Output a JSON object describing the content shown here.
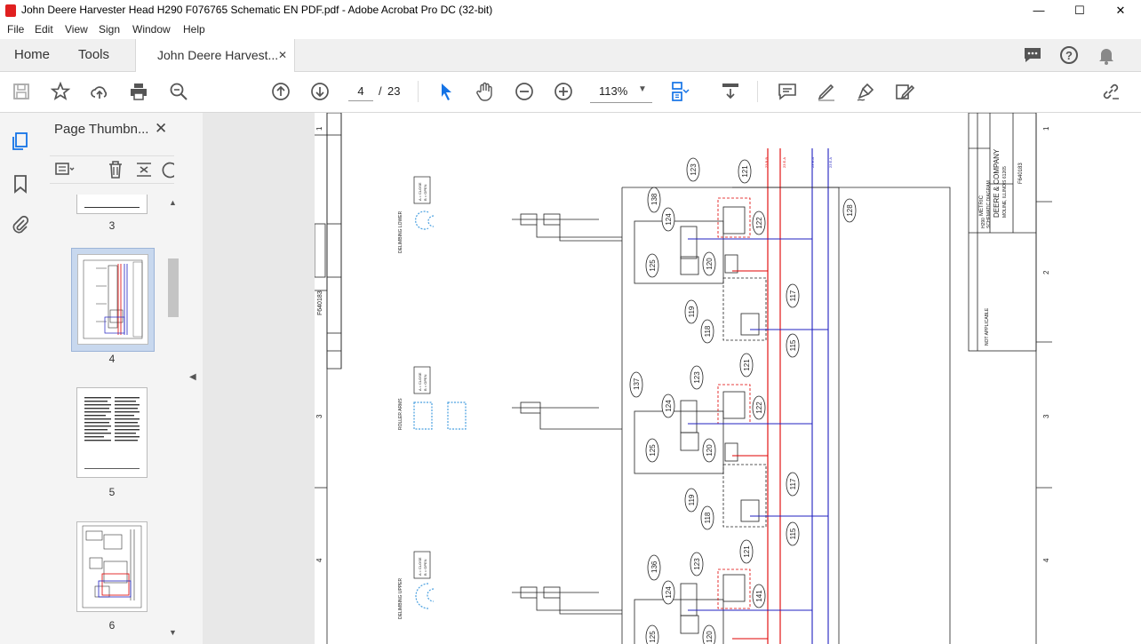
{
  "window": {
    "title": "John Deere Harvester Head H290 F076765 Schematic EN PDF.pdf - Adobe Acrobat Pro DC (32-bit)",
    "minimize": "—",
    "maximize": "☐",
    "close": "✕"
  },
  "menu": [
    "File",
    "Edit",
    "View",
    "Sign",
    "Window",
    "Help"
  ],
  "tabs": {
    "home": "Home",
    "tools": "Tools",
    "document": "John Deere Harvest...",
    "close": "✕"
  },
  "toolbar": {
    "current_page": "4",
    "separator": "/",
    "total_pages": "23",
    "zoom": "113%"
  },
  "panel": {
    "title": "Page Thumbn...",
    "close": "✕",
    "thumbnails": [
      {
        "label": "3"
      },
      {
        "label": "4",
        "selected": true
      },
      {
        "label": "5"
      },
      {
        "label": "6"
      }
    ]
  },
  "schematic": {
    "left_ruler": [
      "1",
      "3",
      "4"
    ],
    "right_ruler": [
      "1",
      "2",
      "3",
      "4"
    ],
    "doc_number": "F640183",
    "title_block": {
      "company": "DEERE & COMPANY",
      "location": "MOLINE, ILLINOIS 61265",
      "model": "H290",
      "drawing": "SCHEMATIC DIAGRAM",
      "code": "F640183",
      "units": "METRIC",
      "note": "NOT APPLICABLE"
    },
    "sections": [
      {
        "name": "DELIMBING LOWER",
        "legend": [
          "A = CLOSE",
          "B = OPEN"
        ],
        "cyl": "138"
      },
      {
        "name": "ROLLER ARMS",
        "legend": [
          "A = CLOSE",
          "B = OPEN"
        ],
        "cyl": "137"
      },
      {
        "name": "DELIMBING UPPER",
        "legend": [
          "A = CLOSE",
          "B = OPEN"
        ],
        "cyl": "136"
      }
    ],
    "callouts": {
      "c123": "123",
      "c121": "121",
      "c124": "124",
      "c122": "122",
      "c125": "125",
      "c120": "120",
      "c119": "119",
      "c118": "118",
      "c117": "117",
      "c115": "115",
      "c128": "128",
      "c141": "141"
    },
    "top_lines": [
      "23 B.B",
      "23 E.A",
      "23 E.A",
      "23 E.A"
    ]
  },
  "colors": {
    "accent": "#1473e6",
    "pdf_red": "#e02020",
    "line_red": "#e00000",
    "line_blue": "#2020c0"
  }
}
